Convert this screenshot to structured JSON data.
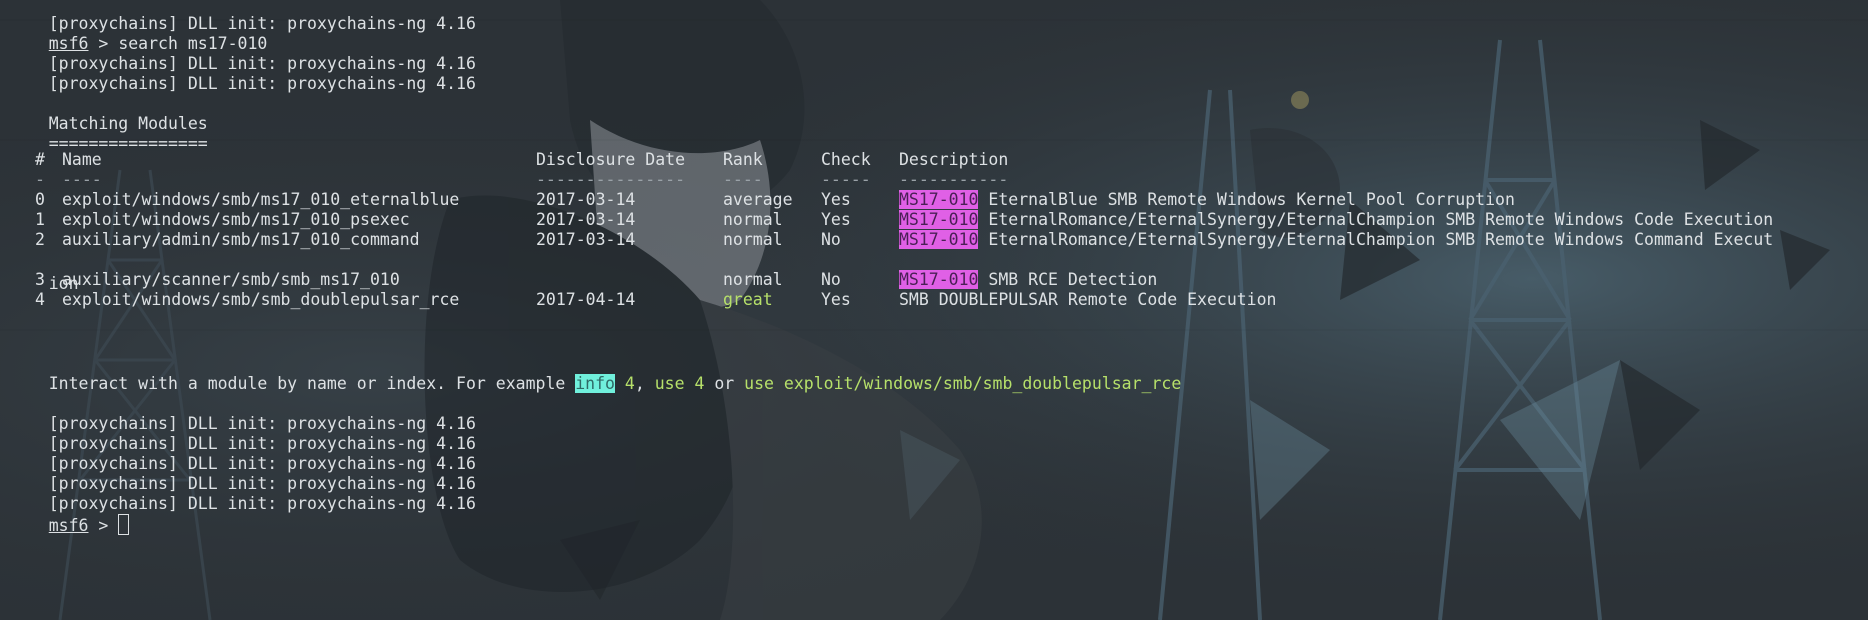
{
  "colors": {
    "highlight_pink": "#e060e6",
    "highlight_cyan": "#70f0dc",
    "accent_green": "#b6e06a",
    "text": "#dde1e4"
  },
  "top_line": "[proxychains] DLL init: proxychains-ng 4.16",
  "prompt": {
    "name": "msf6",
    "arrow": " > ",
    "search_command": "search ms17-010"
  },
  "proxychains_before": [
    "[proxychains] DLL init: proxychains-ng 4.16",
    "[proxychains] DLL init: proxychains-ng 4.16"
  ],
  "section_title": "Matching Modules",
  "section_rule": "================",
  "table": {
    "headers": {
      "num": "#",
      "name": "Name",
      "date": "Disclosure Date",
      "rank": "Rank",
      "check": "Check",
      "description": "Description"
    },
    "separators": {
      "num": "-",
      "name": "----",
      "date": "---------------",
      "rank": "----",
      "check": "-----",
      "description": "-----------"
    },
    "rows": [
      {
        "num": "0",
        "name": "exploit/windows/smb/ms17_010_eternalblue",
        "date": "2017-03-14",
        "rank": "average",
        "check": "Yes",
        "tag": "MS17-010",
        "desc": " EternalBlue SMB Remote Windows Kernel Pool Corruption"
      },
      {
        "num": "1",
        "name": "exploit/windows/smb/ms17_010_psexec",
        "date": "2017-03-14",
        "rank": "normal",
        "check": "Yes",
        "tag": "MS17-010",
        "desc": " EternalRomance/EternalSynergy/EternalChampion SMB Remote Windows Code Execution"
      },
      {
        "num": "2",
        "name": "auxiliary/admin/smb/ms17_010_command",
        "date": "2017-03-14",
        "rank": "normal",
        "check": "No",
        "tag": "MS17-010",
        "desc": " EternalRomance/EternalSynergy/EternalChampion SMB Remote Windows Command Execut",
        "wrap": "ion"
      },
      {
        "num": "3",
        "name": "auxiliary/scanner/smb/smb_ms17_010",
        "date": "",
        "rank": "normal",
        "check": "No",
        "tag": "MS17-010",
        "desc": " SMB RCE Detection"
      },
      {
        "num": "4",
        "name": "exploit/windows/smb/smb_doublepulsar_rce",
        "date": "2017-04-14",
        "rank": "great",
        "check": "Yes",
        "tag": "",
        "desc": "SMB DOUBLEPULSAR Remote Code Execution"
      }
    ]
  },
  "interact": {
    "prefix": "Interact with a module by name or index. For example ",
    "info_word": "info",
    "info_rest": " 4",
    "sep1": ", ",
    "use_index": "use 4",
    "sep2": " or ",
    "use_name": "use exploit/windows/smb/smb_doublepulsar_rce"
  },
  "proxychains_after": [
    "[proxychains] DLL init: proxychains-ng 4.16",
    "[proxychains] DLL init: proxychains-ng 4.16",
    "[proxychains] DLL init: proxychains-ng 4.16",
    "[proxychains] DLL init: proxychains-ng 4.16",
    "[proxychains] DLL init: proxychains-ng 4.16"
  ]
}
